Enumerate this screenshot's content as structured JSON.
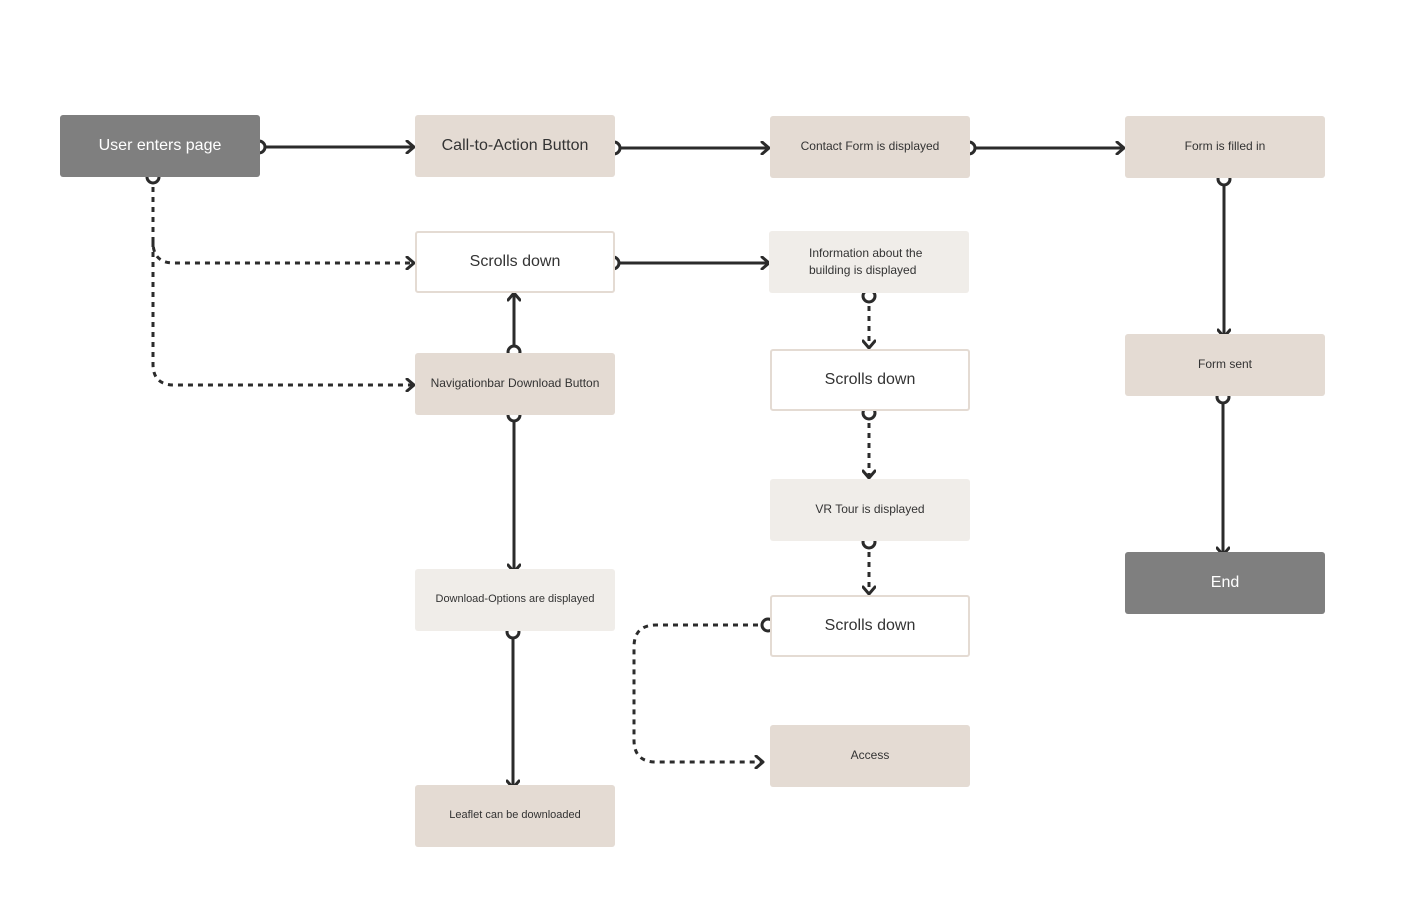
{
  "diagram": {
    "type": "user-flow",
    "colors": {
      "start_end": "#7f7f7f",
      "action": "#e4dbd3",
      "display": "#f0ede9",
      "scroll": "#ffffff",
      "line": "#2b2b2b"
    },
    "nodes": {
      "user_enters_page": "User enters page",
      "cta_button": "Call-to-Action Button",
      "contact_form_displayed": "Contact Form is displayed",
      "form_filled_in": "Form is filled in",
      "scrolls_down_1": "Scrolls down",
      "info_building": "Information about the building is displayed",
      "navbar_download": "Navigationbar Download Button",
      "scrolls_down_2": "Scrolls down",
      "vr_tour": "VR Tour is displayed",
      "scrolls_down_3": "Scrolls down",
      "download_options": "Download-Options are displayed",
      "access": "Access",
      "leaflet": "Leaflet can be downloaded",
      "form_sent": "Form sent",
      "end": "End"
    },
    "edges": [
      {
        "from": "user_enters_page",
        "to": "cta_button",
        "style": "solid"
      },
      {
        "from": "cta_button",
        "to": "contact_form_displayed",
        "style": "solid"
      },
      {
        "from": "contact_form_displayed",
        "to": "form_filled_in",
        "style": "solid"
      },
      {
        "from": "form_filled_in",
        "to": "form_sent",
        "style": "solid"
      },
      {
        "from": "form_sent",
        "to": "end",
        "style": "solid"
      },
      {
        "from": "user_enters_page",
        "to": "scrolls_down_1",
        "style": "dashed"
      },
      {
        "from": "user_enters_page",
        "to": "navbar_download",
        "style": "dashed"
      },
      {
        "from": "scrolls_down_1",
        "to": "info_building",
        "style": "solid"
      },
      {
        "from": "navbar_download",
        "to": "scrolls_down_1",
        "style": "solid"
      },
      {
        "from": "navbar_download",
        "to": "download_options",
        "style": "solid"
      },
      {
        "from": "download_options",
        "to": "leaflet",
        "style": "solid"
      },
      {
        "from": "info_building",
        "to": "scrolls_down_2",
        "style": "dashed"
      },
      {
        "from": "scrolls_down_2",
        "to": "vr_tour",
        "style": "dashed"
      },
      {
        "from": "vr_tour",
        "to": "scrolls_down_3",
        "style": "dashed"
      },
      {
        "from": "scrolls_down_3",
        "to": "access",
        "style": "dashed"
      }
    ]
  }
}
